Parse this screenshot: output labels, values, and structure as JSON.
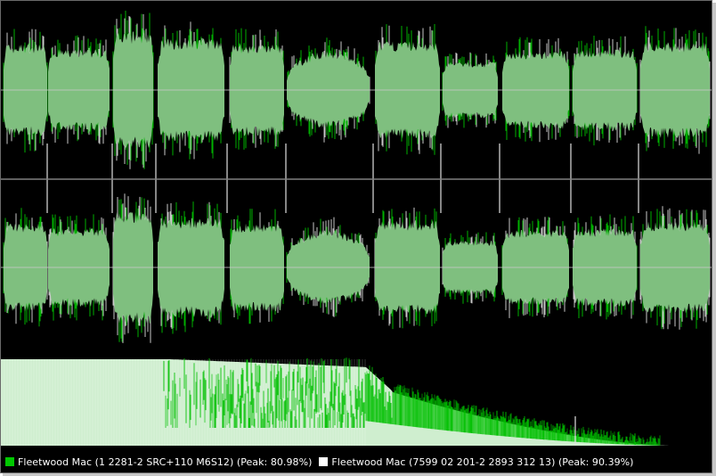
{
  "legend": {
    "track_a": {
      "label": "Fleetwood Mac (1 2281-2 SRC+110 M6S12) (Peak: 80.98%)",
      "color": "#00c800"
    },
    "track_b": {
      "label": "Fleetwood Mac (7599 02 201-2 2893 312 13) (Peak: 90.39%)",
      "color": "#ffffff"
    }
  },
  "colors": {
    "background": "#000000",
    "waveform_fill": "#7fbf7f",
    "waveform_green": "#00b000",
    "waveform_white": "#c8c8c8",
    "center_line": "#c8c8c8",
    "divider": "#808080",
    "spectrum_fill": "#cfeecf",
    "spectrum_green": "#00c000"
  }
}
